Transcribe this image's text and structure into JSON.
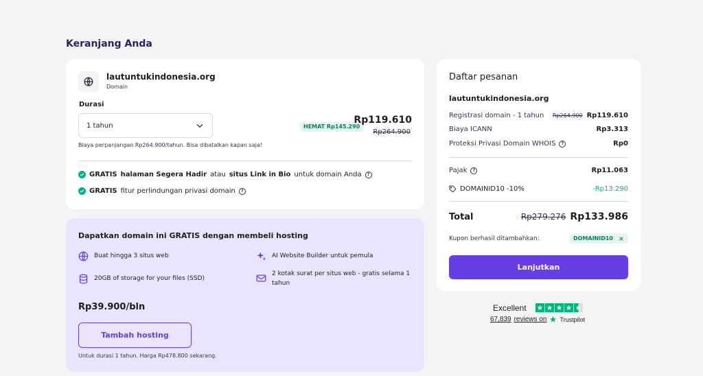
{
  "page": {
    "title": "Keranjang Anda"
  },
  "domain_item": {
    "name": "lautuntukindonesia.org",
    "type": "Domain",
    "duration_label": "Durasi",
    "duration_value": "1 tahun",
    "save_badge": "HEMAT Rp145.290",
    "price": "Rp119.610",
    "old_price": "Rp264.900",
    "renewal_note": "Biaya perpanjangan Rp264.900/tahun. Bisa dibatalkan kapan saja!",
    "features": [
      {
        "gratis": "GRATIS",
        "bold1": "halaman Segera Hadir",
        "mid": "atau",
        "bold2": "situs Link in Bio",
        "rest": "untuk domain Anda"
      },
      {
        "gratis": "GRATIS",
        "rest": "fitur perlindungan privasi domain"
      }
    ]
  },
  "hosting_offer": {
    "title": "Dapatkan domain ini GRATIS dengan membeli hosting",
    "features": [
      {
        "icon": "globe-icon",
        "text": "Buat hingga 3 situs web"
      },
      {
        "icon": "sparkle-icon",
        "text": "AI Website Builder untuk pemula"
      },
      {
        "icon": "database-icon",
        "text": "20GB of storage for your files (SSD)"
      },
      {
        "icon": "mail-icon",
        "text": "2 kotak surat per situs web - gratis selama 1 tahun"
      }
    ],
    "price": "Rp39.900/bln",
    "button_label": "Tambah hosting",
    "note": "Untuk durasi 1 tahun. Harga Rp478.800 sekarang."
  },
  "summary": {
    "title": "Daftar pesanan",
    "domain": "lautuntukindonesia.org",
    "rows": [
      {
        "label": "Registrasi domain - 1 tahun",
        "old": "Rp264.900",
        "value": "Rp119.610"
      },
      {
        "label": "Biaya ICANN",
        "value": "Rp3.313"
      },
      {
        "label": "Proteksi Privasi Domain WHOIS",
        "value": "Rp0"
      }
    ],
    "tax_label": "Pajak",
    "tax_value": "Rp11.063",
    "discount_code": "DOMAINID10 -10%",
    "discount_value": "-Rp13.290",
    "total_label": "Total",
    "total_old": "Rp279.276",
    "total_value": "Rp133.986",
    "coupon_label": "Kupon berhasil ditambahkan:",
    "coupon_code": "DOMAINID10",
    "continue_label": "Lanjutkan"
  },
  "trustpilot": {
    "rating_word": "Excellent",
    "reviews_count": "67,839",
    "reviews_suffix": "reviews on",
    "brand": "Trustpilot",
    "stars": 4.5
  },
  "colors": {
    "accent": "#673de6",
    "success": "#00b090",
    "trustpilot": "#00b67a"
  }
}
